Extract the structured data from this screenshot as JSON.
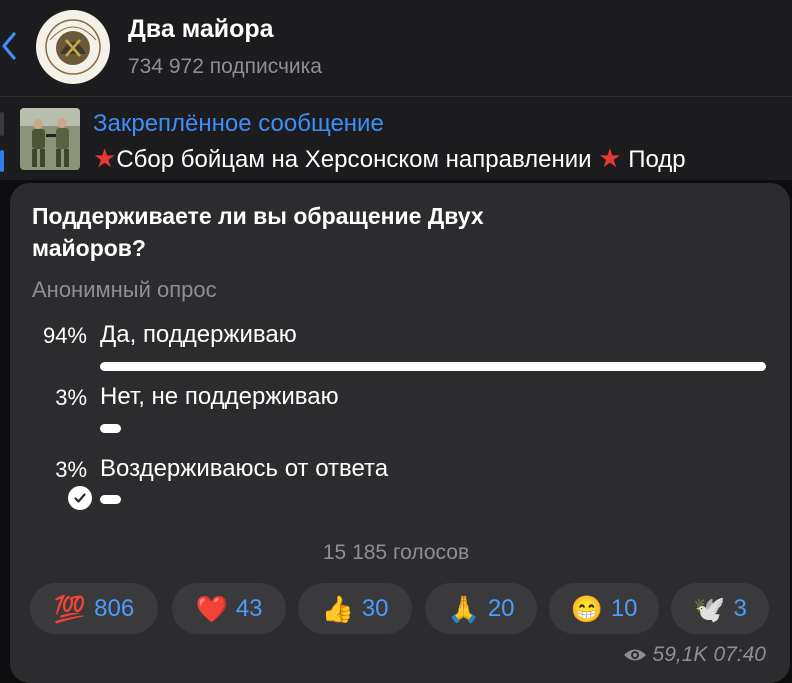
{
  "channel": {
    "title": "Два майора",
    "subscribers": "734 972 подписчика"
  },
  "pinned": {
    "title": "Закреплённое сообщение",
    "text": "Сбор бойцам на Херсонском направлении",
    "text_tail": "Подр"
  },
  "poll": {
    "question": "Поддерживаете ли вы обращение Двух майоров?",
    "type_label": "Анонимный опрос",
    "options": [
      {
        "percent": "94%",
        "label": "Да, поддерживаю",
        "share": 0.94
      },
      {
        "percent": "3%",
        "label": "Нет, не поддерживаю",
        "share": 0.03
      },
      {
        "percent": "3%",
        "label": "Воздерживаюсь от ответа",
        "share": 0.03,
        "selected": true
      }
    ],
    "votes": "15 185 голосов"
  },
  "reactions": [
    {
      "emoji": "💯",
      "count": "806"
    },
    {
      "emoji": "❤️",
      "count": "43"
    },
    {
      "emoji": "👍",
      "count": "30"
    },
    {
      "emoji": "🙏",
      "count": "20"
    },
    {
      "emoji": "😁",
      "count": "10"
    },
    {
      "emoji": "🕊️",
      "count": "3"
    }
  ],
  "meta": {
    "views": "59,1K",
    "time": "07:40"
  },
  "colors": {
    "accent": "#3e8ef7",
    "bubble": "#2c2c2e",
    "reaction_bg": "#3a3a3c"
  }
}
